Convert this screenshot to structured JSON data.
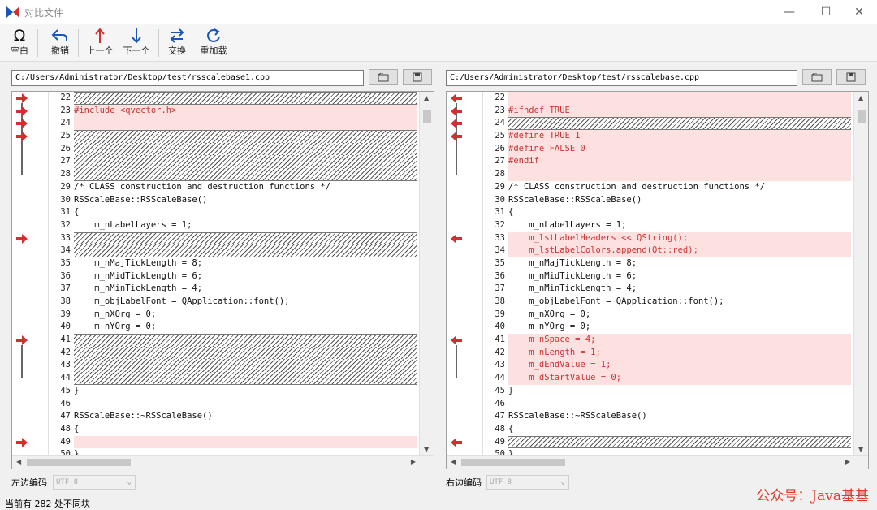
{
  "window": {
    "title": "对比文件"
  },
  "toolbar": {
    "blank_label": "空白",
    "undo_label": "撤销",
    "prev_label": "上一个",
    "next_label": "下一个",
    "swap_label": "交换",
    "reload_label": "重加载"
  },
  "left": {
    "path": "C:/Users/Administrator/Desktop/test/rsscalebase1.cpp",
    "encoding_label": "左边编码",
    "encoding_value": "UTF-8",
    "lines": [
      {
        "n": "22",
        "t": "",
        "s": "hatch"
      },
      {
        "n": "23",
        "t": "#include <qvector.h>",
        "s": "diff"
      },
      {
        "n": "24",
        "t": "",
        "s": "diff"
      },
      {
        "n": "25",
        "t": "",
        "s": "hatch"
      },
      {
        "n": "26",
        "t": "",
        "s": "hatch"
      },
      {
        "n": "27",
        "t": "",
        "s": "hatch"
      },
      {
        "n": "28",
        "t": "",
        "s": "hatch"
      },
      {
        "n": "29",
        "t": "/* CLASS construction and destruction functions */",
        "s": ""
      },
      {
        "n": "30",
        "t": "RSScaleBase::RSScaleBase()",
        "s": ""
      },
      {
        "n": "31",
        "t": "{",
        "s": ""
      },
      {
        "n": "32",
        "t": "    m_nLabelLayers = 1;",
        "s": ""
      },
      {
        "n": "33",
        "t": "",
        "s": "hatch"
      },
      {
        "n": "34",
        "t": "",
        "s": "hatch"
      },
      {
        "n": "35",
        "t": "    m_nMajTickLength = 8;",
        "s": ""
      },
      {
        "n": "36",
        "t": "    m_nMidTickLength = 6;",
        "s": ""
      },
      {
        "n": "37",
        "t": "    m_nMinTickLength = 4;",
        "s": ""
      },
      {
        "n": "38",
        "t": "    m_objLabelFont = QApplication::font();",
        "s": ""
      },
      {
        "n": "39",
        "t": "    m_nXOrg = 0;",
        "s": ""
      },
      {
        "n": "40",
        "t": "    m_nYOrg = 0;",
        "s": ""
      },
      {
        "n": "41",
        "t": "",
        "s": "hatch"
      },
      {
        "n": "42",
        "t": "",
        "s": "hatch"
      },
      {
        "n": "43",
        "t": "",
        "s": "hatch"
      },
      {
        "n": "44",
        "t": "",
        "s": "hatch"
      },
      {
        "n": "45",
        "t": "}",
        "s": ""
      },
      {
        "n": "46",
        "t": "",
        "s": ""
      },
      {
        "n": "47",
        "t": "RSScaleBase::~RSScaleBase()",
        "s": ""
      },
      {
        "n": "48",
        "t": "{",
        "s": ""
      },
      {
        "n": "49",
        "t": "",
        "s": "diff"
      },
      {
        "n": "50",
        "t": "}",
        "s": ""
      }
    ]
  },
  "right": {
    "path": "C:/Users/Administrator/Desktop/test/rsscalebase.cpp",
    "encoding_label": "右边编码",
    "encoding_value": "UTF-8",
    "lines": [
      {
        "n": "22",
        "t": "",
        "s": "diff"
      },
      {
        "n": "23",
        "t": "#ifndef TRUE",
        "s": "diff"
      },
      {
        "n": "24",
        "t": "",
        "s": "hatch"
      },
      {
        "n": "25",
        "t": "#define TRUE 1",
        "s": "diff"
      },
      {
        "n": "26",
        "t": "#define FALSE 0",
        "s": "diff"
      },
      {
        "n": "27",
        "t": "#endif",
        "s": "diff"
      },
      {
        "n": "28",
        "t": "",
        "s": "diff"
      },
      {
        "n": "29",
        "t": "/* CLASS construction and destruction functions */",
        "s": ""
      },
      {
        "n": "30",
        "t": "RSScaleBase::RSScaleBase()",
        "s": ""
      },
      {
        "n": "31",
        "t": "{",
        "s": ""
      },
      {
        "n": "32",
        "t": "    m_nLabelLayers = 1;",
        "s": ""
      },
      {
        "n": "33",
        "t": "    m_lstLabelHeaders << QString();",
        "s": "diff"
      },
      {
        "n": "34",
        "t": "    m_lstLabelColors.append(Qt::red);",
        "s": "diff"
      },
      {
        "n": "35",
        "t": "    m_nMajTickLength = 8;",
        "s": ""
      },
      {
        "n": "36",
        "t": "    m_nMidTickLength = 6;",
        "s": ""
      },
      {
        "n": "37",
        "t": "    m_nMinTickLength = 4;",
        "s": ""
      },
      {
        "n": "38",
        "t": "    m_objLabelFont = QApplication::font();",
        "s": ""
      },
      {
        "n": "39",
        "t": "    m_nXOrg = 0;",
        "s": ""
      },
      {
        "n": "40",
        "t": "    m_nYOrg = 0;",
        "s": ""
      },
      {
        "n": "41",
        "t": "    m_nSpace = 4;",
        "s": "diff"
      },
      {
        "n": "42",
        "t": "    m_nLength = 1;",
        "s": "diff"
      },
      {
        "n": "43",
        "t": "    m_dEndValue = 1;",
        "s": "diff"
      },
      {
        "n": "44",
        "t": "    m_dStartValue = 0;",
        "s": "diff"
      },
      {
        "n": "45",
        "t": "}",
        "s": ""
      },
      {
        "n": "46",
        "t": "",
        "s": ""
      },
      {
        "n": "47",
        "t": "RSScaleBase::~RSScaleBase()",
        "s": ""
      },
      {
        "n": "48",
        "t": "{",
        "s": ""
      },
      {
        "n": "49",
        "t": "",
        "s": "hatch"
      },
      {
        "n": "50",
        "t": "}",
        "s": ""
      }
    ]
  },
  "left_markers": [
    22,
    23,
    24,
    25,
    33,
    41,
    49
  ],
  "right_markers": [
    22,
    23,
    24,
    25,
    33,
    41,
    49
  ],
  "status": {
    "text": "当前有 282 处不同块"
  },
  "watermark": {
    "text": "公众号：Java基基"
  },
  "colors": {
    "diff_bg": "#fde1e1",
    "diff_text": "#cc3333",
    "arrow": "#d32f2f",
    "accent": "#1a55b8"
  }
}
